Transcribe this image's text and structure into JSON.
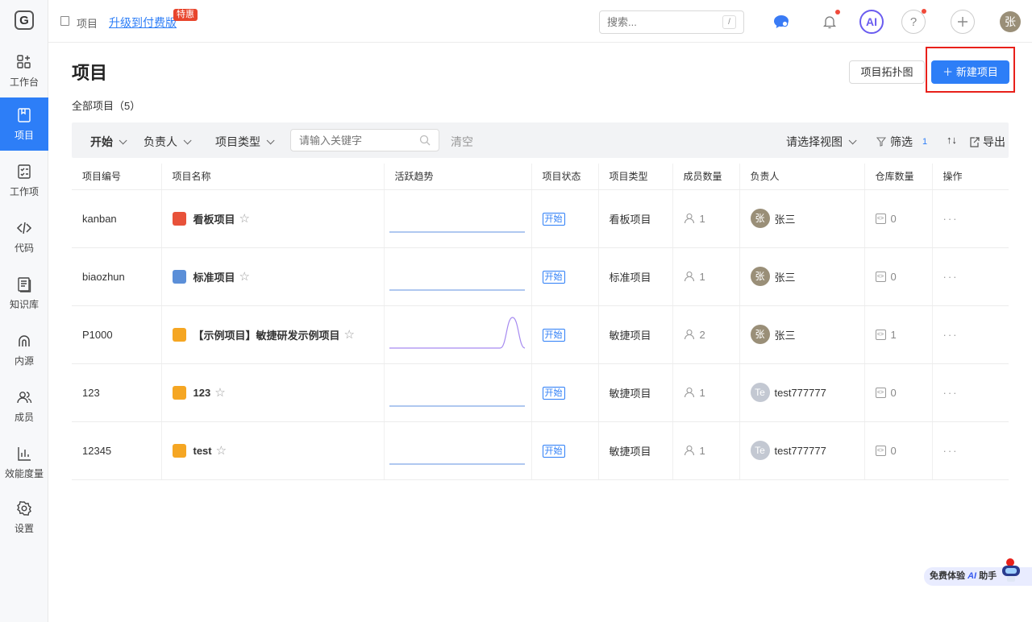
{
  "sidebar": {
    "logo": "G",
    "items": [
      {
        "label": "工作台",
        "icon": "grid-icon"
      },
      {
        "label": "项目",
        "icon": "book-icon"
      },
      {
        "label": "工作项",
        "icon": "checklist-icon"
      },
      {
        "label": "代码",
        "icon": "code-icon"
      },
      {
        "label": "知识库",
        "icon": "document-icon"
      },
      {
        "label": "内源",
        "icon": "source-icon"
      },
      {
        "label": "成员",
        "icon": "users-icon"
      },
      {
        "label": "效能度量",
        "icon": "bar-chart-icon"
      },
      {
        "label": "设置",
        "icon": "gear-icon"
      }
    ]
  },
  "topbar": {
    "breadcrumb": "项目",
    "upgrade_link": "升级到付费版",
    "upgrade_badge": "特惠",
    "search_placeholder": "搜索...",
    "search_shortcut": "/",
    "ai_label": "AI",
    "help_label": "?",
    "user_avatar": "张"
  },
  "page": {
    "title": "项目",
    "topology_button": "项目拓扑图",
    "new_button": "新建项目",
    "all_count": "全部项目（5）"
  },
  "filters": {
    "status": "开始",
    "owner": "负责人",
    "type": "项目类型",
    "keyword_placeholder": "请输入关键字",
    "clear": "清空",
    "view": "请选择视图",
    "filter": "筛选",
    "filter_count": "1",
    "sort": "↑↓",
    "export": "导出"
  },
  "table": {
    "headers": [
      "项目编号",
      "项目名称",
      "活跃趋势",
      "项目状态",
      "项目类型",
      "成员数量",
      "负责人",
      "仓库数量",
      "操作"
    ],
    "rows": [
      {
        "id": "kanban",
        "name": "看板项目",
        "icon_color": "#e8523a",
        "status": "开始",
        "type": "看板项目",
        "members": "1",
        "owner": "张三",
        "owner_avatar": "张",
        "avatar_color": "#9a8f78",
        "repos": "0",
        "trend": [
          0,
          0,
          0,
          0,
          0,
          0,
          0,
          0,
          0,
          0,
          0,
          0
        ],
        "ops": "···"
      },
      {
        "id": "biaozhun",
        "name": "标准项目",
        "icon_color": "#5b8fd8",
        "status": "开始",
        "type": "标准项目",
        "members": "1",
        "owner": "张三",
        "owner_avatar": "张",
        "avatar_color": "#9a8f78",
        "repos": "0",
        "trend": [
          0,
          0,
          0,
          0,
          0,
          0,
          0,
          0,
          0,
          0,
          0,
          0
        ],
        "ops": "···"
      },
      {
        "id": "P1000",
        "name": "【示例项目】敏捷研发示例项目",
        "icon_color": "#f5a623",
        "status": "开始",
        "type": "敏捷项目",
        "members": "2",
        "owner": "张三",
        "owner_avatar": "张",
        "avatar_color": "#9a8f78",
        "repos": "1",
        "trend": [
          0,
          0,
          0,
          0,
          0,
          0,
          0,
          0,
          0,
          0,
          1,
          0
        ],
        "ops": "···"
      },
      {
        "id": "123",
        "name": "123",
        "icon_color": "#f5a623",
        "status": "开始",
        "type": "敏捷项目",
        "members": "1",
        "owner": "test777777",
        "owner_avatar": "Te",
        "avatar_color": "#c3c8d2",
        "repos": "0",
        "trend": [
          0,
          0,
          0,
          0,
          0,
          0,
          0,
          0,
          0,
          0,
          0,
          0
        ],
        "ops": "···"
      },
      {
        "id": "12345",
        "name": "test",
        "icon_color": "#f5a623",
        "status": "开始",
        "type": "敏捷项目",
        "members": "1",
        "owner": "test777777",
        "owner_avatar": "Te",
        "avatar_color": "#c3c8d2",
        "repos": "0",
        "trend": [
          0,
          0,
          0,
          0,
          0,
          0,
          0,
          0,
          0,
          0,
          0,
          0
        ],
        "ops": "···"
      }
    ]
  },
  "promo": {
    "text_before": "免费体验",
    "ai": "AI",
    "text_after": "助手"
  },
  "colors": {
    "accent": "#2d7ef7",
    "highlight": "#e8201a"
  }
}
